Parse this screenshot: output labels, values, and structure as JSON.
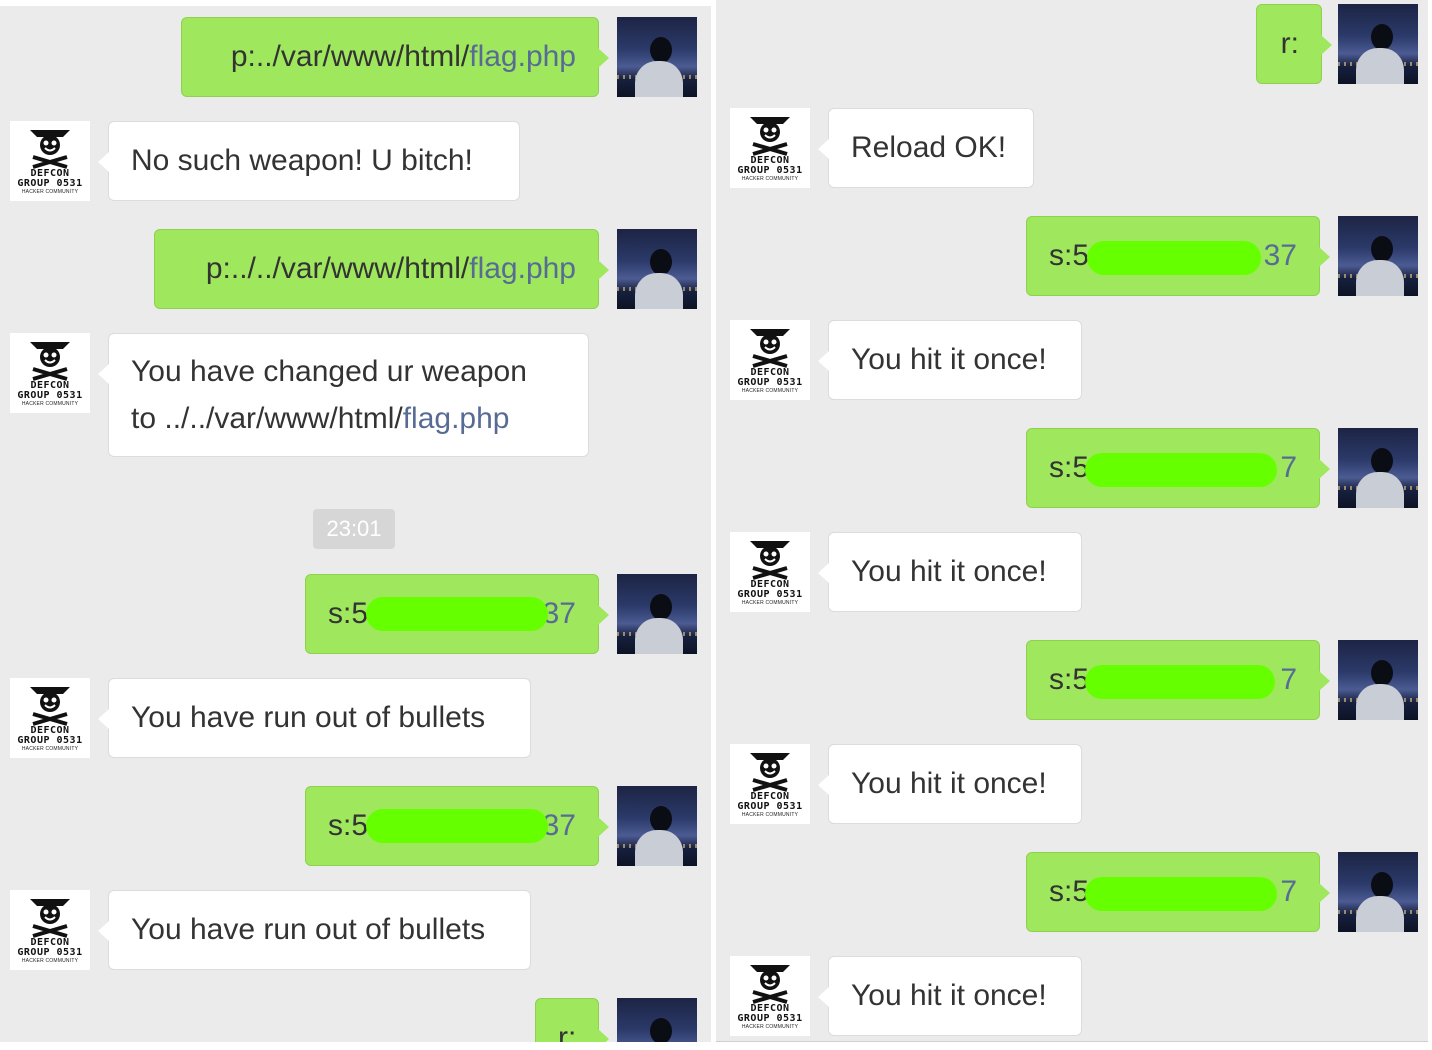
{
  "theme": {
    "outgoing_bubble": "#9fe85d",
    "incoming_bubble": "#ffffff",
    "link": "#576b95",
    "censor": "#66ff00",
    "background": "#ebebeb"
  },
  "avatars": {
    "self": {
      "icon": "night-city-person-avatar-icon"
    },
    "bot": {
      "icon": "defcon-skull-logo-icon",
      "line1": "DEFCON",
      "line2": "GROUP 0531",
      "line3": "HACKER COMMUNITY"
    }
  },
  "left": {
    "timestamp": "23:01",
    "messages": [
      {
        "dir": "out",
        "text": "p:../var/www/html/",
        "link": "flag.php"
      },
      {
        "dir": "in",
        "text": "No such weapon! U bitch!"
      },
      {
        "dir": "out",
        "text": "p:../../var/www/html/",
        "link": "flag.php"
      },
      {
        "dir": "in",
        "line1": "You have changed ur weapon",
        "line2": "to ../../var/www/html/",
        "link": "flag.php"
      },
      {
        "dir": "out",
        "prefix": "s:5",
        "suffix": "37"
      },
      {
        "dir": "in",
        "text": "You have run out of bullets"
      },
      {
        "dir": "out",
        "prefix": "s:5",
        "suffix": "37"
      },
      {
        "dir": "in",
        "text": "You have run out of bullets"
      },
      {
        "dir": "out",
        "text": "r:"
      }
    ]
  },
  "right": {
    "messages": [
      {
        "dir": "out",
        "text": "r:"
      },
      {
        "dir": "in",
        "text": "Reload OK!"
      },
      {
        "dir": "out",
        "prefix": "s:5",
        "suffix": "37"
      },
      {
        "dir": "in",
        "text": "You hit it once!"
      },
      {
        "dir": "out",
        "prefix": "s:5",
        "suffix": "7"
      },
      {
        "dir": "in",
        "text": "You hit it once!"
      },
      {
        "dir": "out",
        "prefix": "s:5",
        "suffix": "7"
      },
      {
        "dir": "in",
        "text": "You hit it once!"
      },
      {
        "dir": "out",
        "prefix": "s:5",
        "suffix": "7"
      },
      {
        "dir": "in",
        "text": "You hit it once!"
      }
    ]
  }
}
